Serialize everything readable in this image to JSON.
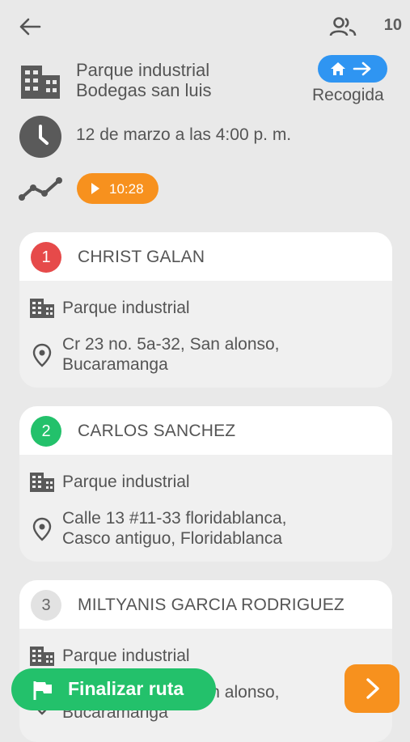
{
  "header": {
    "passenger_count": "10"
  },
  "pickup": {
    "address_line1": "Parque industrial",
    "address_line2": "Bodegas san luis",
    "type_label": "Recogida",
    "datetime": "12 de marzo a las 4:00 p. m.",
    "timer": "10:28"
  },
  "passengers": [
    {
      "number": "1",
      "name": "CHRIST GALAN",
      "place": "Parque industrial",
      "address_line1": "Cr 23 no. 5a-32, San alonso,",
      "address_line2": "Bucaramanga",
      "badge_color": "#e64a4a"
    },
    {
      "number": "2",
      "name": "CARLOS SANCHEZ",
      "place": "Parque industrial",
      "address_line1": "Calle 13 #11-33 floridablanca,",
      "address_line2": "Casco antiguo, Floridablanca",
      "badge_color": "#23c16b"
    },
    {
      "number": "3",
      "name": "MILTYANIS GARCIA RODRIGUEZ",
      "place": "Parque industrial",
      "address_line1": "Cr 23 no. 5a-32, San alonso,",
      "address_line2": "Bucaramanga",
      "badge_color": "#e2e2e2"
    }
  ],
  "actions": {
    "finish_label": "Finalizar ruta"
  },
  "colors": {
    "accent_blue": "#2f95f2",
    "accent_orange": "#f7911e",
    "accent_green": "#23c16b"
  }
}
